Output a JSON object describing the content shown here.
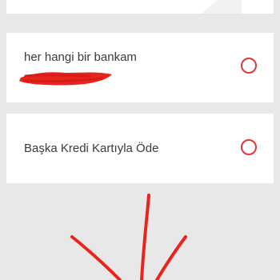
{
  "payment_options": [
    {
      "label": "her hangi bir bankam",
      "selected": false
    },
    {
      "label": "Başka Kredi Kartıyla Öde",
      "selected": false
    }
  ],
  "colors": {
    "accent": "#e0353b",
    "background": "#e8e8e8",
    "card": "#ffffff",
    "text": "#3a3a3a",
    "annotation": "#e8241f"
  },
  "icons": {
    "radio": "radio-unselected-icon"
  }
}
